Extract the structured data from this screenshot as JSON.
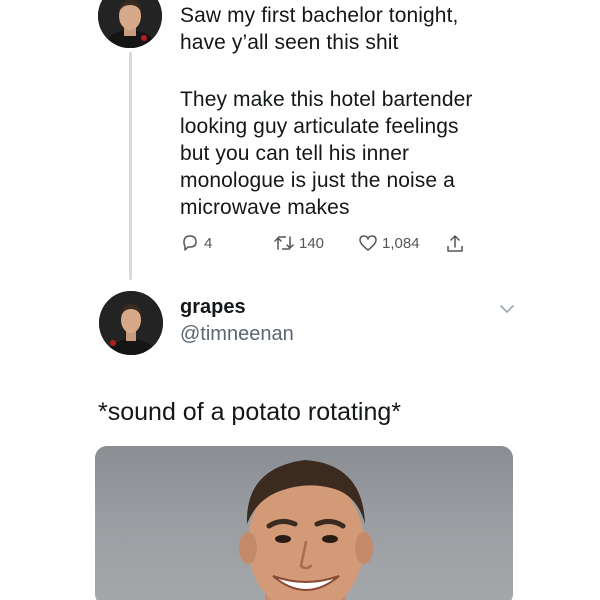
{
  "original_tweet": {
    "text_line_block_1": "Saw my first bachelor tonight,\nhave y’all seen this shit",
    "text_line_block_2": "They make this hotel bartender\nlooking guy articulate feelings\nbut you can tell his inner\nmonologue is just the noise a\nmicrowave makes",
    "replies_count": "4",
    "retweets_count": "140",
    "likes_count": "1,084"
  },
  "reply_tweet": {
    "display_name": "grapes",
    "handle": "@timneenan",
    "text": "*sound of a potato rotating*"
  },
  "icons": {
    "reply": "reply-icon",
    "retweet": "retweet-icon",
    "like": "heart-icon",
    "share": "share-icon",
    "menu": "chevron-down-icon"
  },
  "colors": {
    "text": "#14171a",
    "secondary": "#5b6670",
    "thread_line": "#d6dadd"
  }
}
